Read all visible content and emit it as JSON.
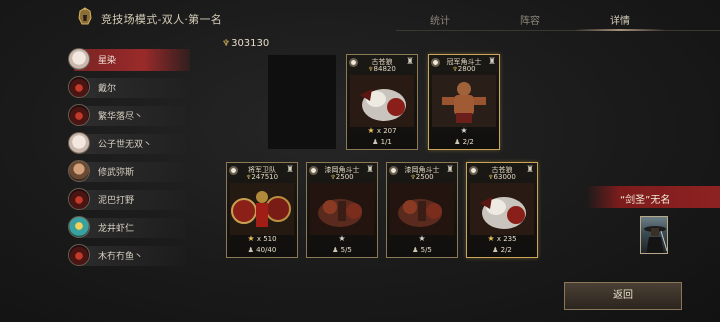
{
  "header": {
    "mode_title": "竞技场模式-双人·第一名",
    "tabs": [
      "统计",
      "阵容",
      "详情"
    ],
    "active_tab": "详情"
  },
  "players": [
    {
      "name": "星染",
      "avatar": "pale",
      "selected": true
    },
    {
      "name": "戴尔",
      "avatar": "red"
    },
    {
      "name": "繁华落尽丶",
      "avatar": "red"
    },
    {
      "name": "公子世无双丶",
      "avatar": "pale"
    },
    {
      "name": "修武弥斯",
      "avatar": "face"
    },
    {
      "name": "泥巴打野",
      "avatar": "red"
    },
    {
      "name": "龙井虾仁",
      "avatar": "teal"
    },
    {
      "name": "木冇冇鱼丶",
      "avatar": "red"
    }
  ],
  "power_total": "303130",
  "cards": [
    {
      "title": "古苍狼",
      "power": "84820",
      "star_text": "x 207",
      "count": "1/1",
      "art": "wolf",
      "star_gold": true
    },
    {
      "title": "冠军角斗士",
      "power": "2800",
      "star_text": "",
      "count": "2/2",
      "art": "gladiator",
      "star_gold": false
    },
    {
      "title": "将军卫队",
      "power": "247510",
      "star_text": "x 510",
      "count": "40/40",
      "art": "guard",
      "star_gold": true
    },
    {
      "title": "漆岡角斗士",
      "power": "2500",
      "star_text": "",
      "count": "5/5",
      "art": "beast",
      "star_gold": false
    },
    {
      "title": "漆岡角斗士",
      "power": "2500",
      "star_text": "",
      "count": "5/5",
      "art": "beast",
      "star_gold": false
    },
    {
      "title": "古苍狼",
      "power": "63000",
      "star_text": "x 235",
      "count": "2/2",
      "art": "wolf",
      "star_gold": true
    }
  ],
  "opponent": {
    "name": "“剑圣”无名"
  },
  "back_button": "返回",
  "colors": {
    "accent_red": "#9a2a2a",
    "gold": "#c9a757",
    "bg": "#1a1a1a"
  }
}
